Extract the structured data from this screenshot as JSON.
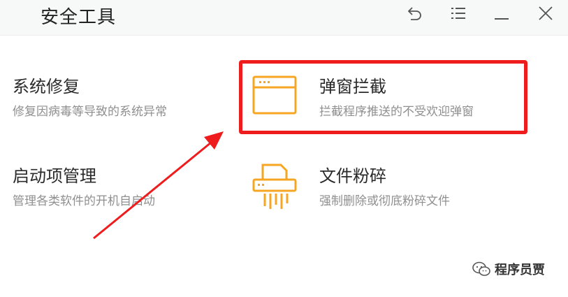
{
  "window": {
    "title": "安全工具"
  },
  "titlebar_icons": {
    "back": "undo-arrow-icon",
    "menu": "list-menu-icon",
    "minimize": "minimize-icon",
    "close": "close-icon"
  },
  "tools": [
    {
      "name": "系统修复",
      "desc": "修复因病毒等导致的系统异常",
      "icon": "none"
    },
    {
      "name": "弹窗拦截",
      "desc": "拦截程序推送的不受欢迎弹窗",
      "icon": "browser-window-icon"
    },
    {
      "name": "启动项管理",
      "desc": "管理各类软件的开机自启动",
      "icon": "none"
    },
    {
      "name": "文件粉碎",
      "desc": "强制删除或彻底粉碎文件",
      "icon": "shredder-icon"
    }
  ],
  "annotation": {
    "highlight_color": "#ee1c1c",
    "arrow_color": "#ee1c1c"
  },
  "colors": {
    "accent_orange": "#f6a623"
  },
  "watermark": {
    "text": "程序员贾",
    "icon": "wechat-icon"
  }
}
